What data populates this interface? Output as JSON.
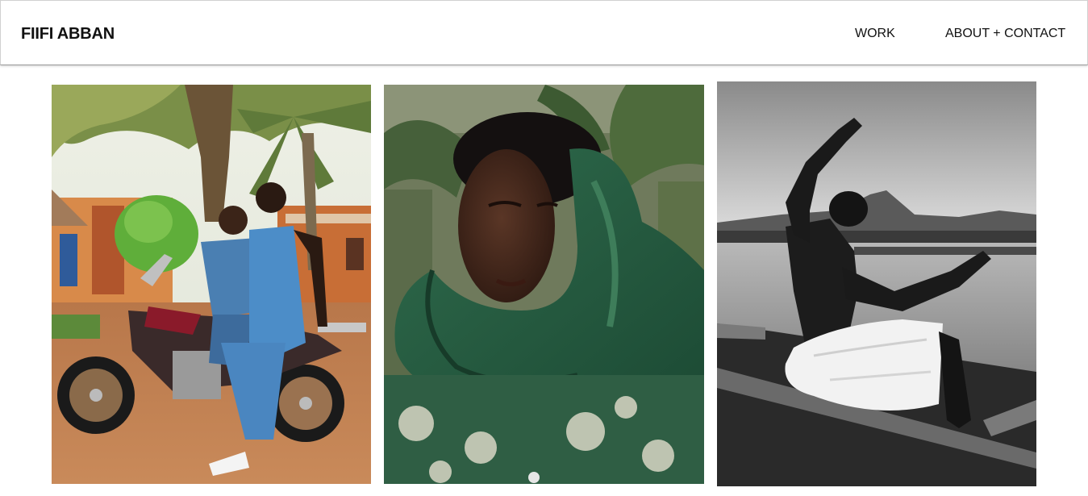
{
  "site": {
    "logo": "FIIFI ABBAN"
  },
  "nav": {
    "items": [
      {
        "label": "WORK"
      },
      {
        "label": "ABOUT + CONTACT"
      }
    ]
  },
  "gallery": {
    "photos": [
      {
        "subject": "couple-on-motorcycle-photo"
      },
      {
        "subject": "portrait-green-scarf-photo"
      },
      {
        "subject": "man-in-canoe-bw-photo"
      }
    ]
  },
  "colors": {
    "text": "#111111",
    "header_border": "#9a9a9a",
    "background": "#ffffff"
  }
}
